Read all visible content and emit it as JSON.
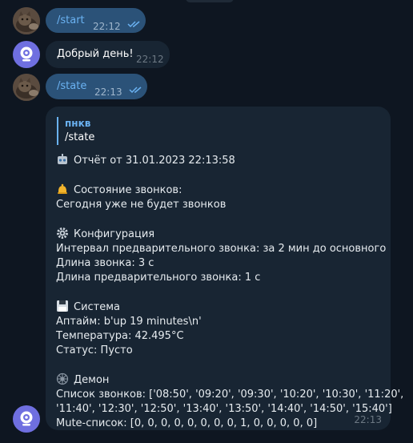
{
  "chat": {
    "messages": [
      {
        "text": "/start",
        "time": "22:12"
      },
      {
        "text": "Добрый день!",
        "time": "22:12"
      },
      {
        "text": "/state",
        "time": "22:13"
      }
    ],
    "report": {
      "reply_author": "пнкв",
      "reply_text": "/state",
      "title": "Отчёт от 31.01.2023 22:13:58",
      "bell_header": "Состояние звонков:",
      "bell_status": "Сегодня уже не будет звонков",
      "config_header": "Конфигурация",
      "config_line1": "Интервал предварительного звонка: за 2 мин до основного",
      "config_line2": "Длина звонка: 3 с",
      "config_line3": "Длина предварительного звонка: 1 с",
      "system_header": "Система",
      "system_uptime": "Аптайм: b'up 19 minutes\\n'",
      "system_temp": "Температура: 42.495°C",
      "system_status": "Статус: Пусто",
      "daemon_header": "Демон",
      "daemon_list1": "Список звонков: ['08:50', '09:20', '09:30', '10:20', '10:30', '11:20',",
      "daemon_list2": "'11:40', '12:30', '12:50', '13:40', '13:50', '14:40', '14:50', '15:40']",
      "daemon_mute": "Mute-список: [0, 0, 0, 0, 0, 0, 0, 0, 1, 0, 0, 0, 0, 0]",
      "time": "22:13"
    }
  },
  "colors": {
    "background": "#0e1621",
    "outgoing_bubble": "#2b5278",
    "incoming_bubble": "#182533",
    "accent": "#6ab2f2"
  },
  "icons": [
    "user-avatar-icon",
    "bot-avatar-icon",
    "double-check-icon",
    "robot-icon",
    "bell-icon",
    "gear-icon",
    "floppy-disk-icon",
    "wheel-icon"
  ]
}
